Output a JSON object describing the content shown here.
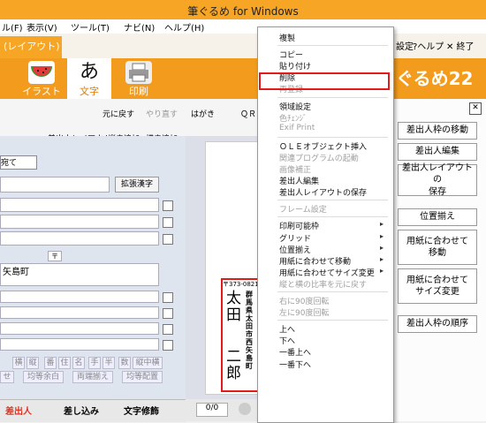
{
  "title": "筆ぐるめ for Windows",
  "menubar": [
    "ル(F)",
    "表示(V)",
    "ツール(T)",
    "ナビ(N)",
    "ヘルプ(H)"
  ],
  "ribbon": {
    "tab_label": "(レイアウト)",
    "buttons": [
      "イラスト",
      "文字",
      "印刷"
    ],
    "brand": "ぐるめ22",
    "right_links": [
      "設定",
      "?ヘルプ",
      "✕ 終了"
    ]
  },
  "toolbar2": {
    "undo": "元に戻す",
    "redo": "やり直す",
    "sender_layout": "差出人レイアウト",
    "vertical_add": "縦書追加",
    "horizontal_add": "横書追加"
  },
  "panel": {
    "tab": "宛て",
    "expand_kanji": "拡張漢字",
    "postal_dash": "〒",
    "address": "矢島町",
    "buttons_row1": [
      "横",
      "縦",
      "番",
      "住",
      "名",
      "手",
      "半",
      "数",
      "縦中横"
    ],
    "buttons_row2": [
      "せ",
      "均等余白",
      "両端揃え",
      "均等配置"
    ]
  },
  "bottom_tabs": [
    "差出人",
    "差し込み",
    "文字修飾"
  ],
  "middle": {
    "hagaki": "はがき",
    "qr": "ＱＲコ",
    "page": "0/0"
  },
  "sender_card": {
    "postal": "〒373-0821",
    "col1": "群馬県太田市西矢島町",
    "col2": "太田",
    "col3": "二郎"
  },
  "right_buttons": [
    "差出人枠の移動",
    "差出人編集",
    "差出人レイアウトの\n保存",
    "位置揃え",
    "用紙に合わせて\n移動",
    "用紙に合わせて\nサイズ変更",
    "差出人枠の順序"
  ],
  "context_menu": [
    {
      "label": "複製",
      "disabled": false
    },
    {
      "sep": true
    },
    {
      "label": "コピー",
      "disabled": false
    },
    {
      "label": "貼り付け",
      "disabled": false
    },
    {
      "label": "削除",
      "disabled": false,
      "highlighted": true
    },
    {
      "label": "再登録",
      "disabled": true
    },
    {
      "sep": true
    },
    {
      "label": "領域設定",
      "disabled": false
    },
    {
      "label": "色ﾁｪﾝｼﾞ",
      "disabled": true
    },
    {
      "label": "Exif Print",
      "disabled": true
    },
    {
      "sep": true
    },
    {
      "label": "ＯＬＥオブジェクト挿入",
      "disabled": false
    },
    {
      "label": "関連プログラムの起動",
      "disabled": true
    },
    {
      "label": "画像補正",
      "disabled": true
    },
    {
      "label": "差出人編集",
      "disabled": false
    },
    {
      "label": "差出人レイアウトの保存",
      "disabled": false
    },
    {
      "sep": true
    },
    {
      "label": "フレーム設定",
      "disabled": true
    },
    {
      "sep": true
    },
    {
      "label": "印刷可能枠",
      "disabled": false,
      "submenu": true
    },
    {
      "label": "グリッド",
      "disabled": false,
      "submenu": true
    },
    {
      "label": "位置揃え",
      "disabled": false,
      "submenu": true
    },
    {
      "label": "用紙に合わせて移動",
      "disabled": false,
      "submenu": true
    },
    {
      "label": "用紙に合わせてサイズ変更",
      "disabled": false,
      "submenu": true
    },
    {
      "label": "縦と横の比率を元に戻す",
      "disabled": true
    },
    {
      "sep": true
    },
    {
      "label": "右に90度回転",
      "disabled": true
    },
    {
      "label": "左に90度回転",
      "disabled": true
    },
    {
      "sep": true
    },
    {
      "label": "上へ",
      "disabled": false
    },
    {
      "label": "下へ",
      "disabled": false
    },
    {
      "label": "一番上へ",
      "disabled": false
    },
    {
      "label": "一番下へ",
      "disabled": false
    }
  ]
}
